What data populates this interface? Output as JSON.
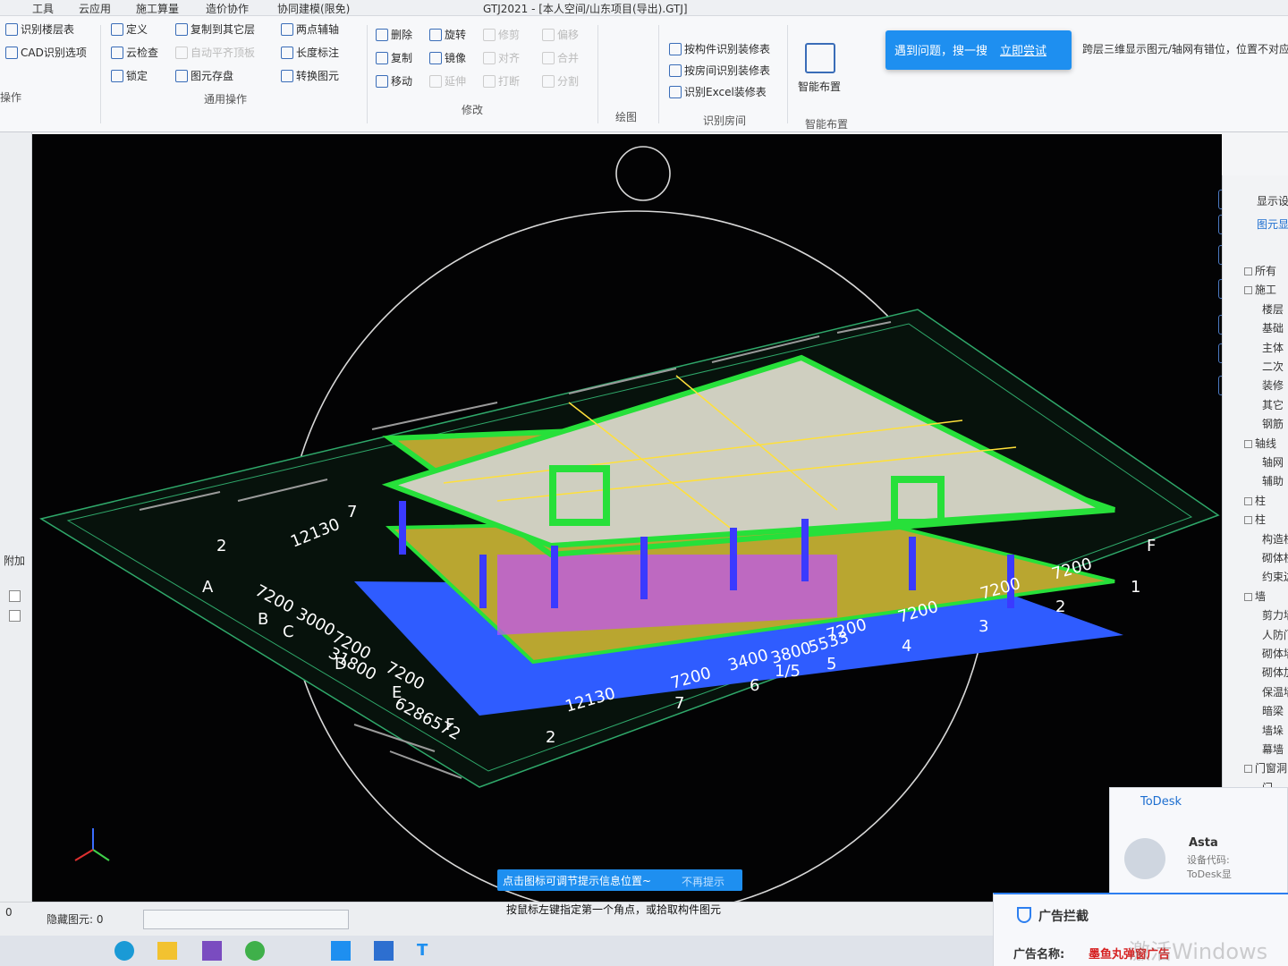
{
  "menubar": {
    "items": [
      "工具",
      "云应用",
      "施工算量",
      "造价协作",
      "协同建模(限免)"
    ],
    "doc_title": "GTJ2021 - [本人空间/山东项目(导出).GTJ]"
  },
  "ribbon": {
    "col1": [
      "识别楼层表",
      "CAD识别选项"
    ],
    "col1_group": "操作",
    "col2": [
      "定义",
      "云检查",
      "锁定"
    ],
    "col3": [
      "复制到其它层",
      "自动平齐顶板",
      "图元存盘"
    ],
    "col4": [
      "两点辅轴",
      "长度标注",
      "转换图元"
    ],
    "group_general": "通用操作",
    "modify_col1": [
      "删除",
      "复制",
      "移动"
    ],
    "modify_col2": [
      "旋转",
      "镜像",
      "延伸"
    ],
    "modify_col3": [
      "修剪",
      "对齐",
      "打断"
    ],
    "modify_col4": [
      "偏移",
      "合并",
      "分割"
    ],
    "group_modify": "修改",
    "group_draw": "绘图",
    "recognize_room": [
      "按构件识别装修表",
      "按房间识别装修表",
      "识别Excel装修表"
    ],
    "group_room": "识别房间",
    "smart_layout": "智能布置",
    "group_smart": "智能布置"
  },
  "ai_search": {
    "text": "遇到问题，搜一搜",
    "button": "立即尝试",
    "hint": "跨层三维显示图元/轴网有错位，位置不对应"
  },
  "left": {
    "add_label": "附加"
  },
  "viewport": {
    "dims": [
      "12130",
      "7200",
      "3000",
      "7200",
      "31800",
      "7200",
      "6286572",
      "12130",
      "7200",
      "3400",
      "3800",
      "5533",
      "7200",
      "7200",
      "7200",
      "7200",
      "1/5"
    ],
    "axis_letters": [
      "A",
      "B",
      "C",
      "D",
      "E",
      "F",
      "F"
    ],
    "axis_numbers": [
      "2",
      "7",
      "2",
      "7",
      "6",
      "5",
      "4",
      "3",
      "2",
      "1"
    ]
  },
  "rightpanel": {
    "header": "显示设置",
    "tab": "图元显示",
    "items": [
      "所有",
      "施工",
      "楼层",
      "基础",
      "主体",
      "二次",
      "装修",
      "其它",
      "钢筋",
      "轴线",
      "轴网",
      "辅助",
      "柱",
      "柱",
      "构造柱",
      "砌体柱",
      "约束边",
      "墙",
      "剪力墙",
      "人防门框墙",
      "砌体墙",
      "砌体加筋",
      "保温墙",
      "暗梁",
      "墙垛",
      "幕墙",
      "门窗洞",
      "门"
    ]
  },
  "tip_banner": {
    "text": "点击图标可调节提示信息位置~",
    "dismiss": "不再提示"
  },
  "prompt": "按鼠标左键指定第一个角点，或拾取构件图元",
  "status": {
    "hidden_label": "隐藏图元: 0",
    "left_zero": "0"
  },
  "todesk": {
    "brand": "ToDesk",
    "user": "Asta",
    "code_label": "设备代码: ",
    "sub": "ToDesk显"
  },
  "adblock": {
    "title": "广告拦截",
    "name_label": "广告名称: ",
    "name_value": "墨鱼丸弹窗广告"
  },
  "watermark": "激活Windows",
  "colors": {
    "viewport_bg": "#030304",
    "slab_green": "#27e03a",
    "wall_olive": "#b9a630",
    "column_blue": "#3a3aff",
    "foundation_blue": "#2f5cff",
    "accent": "#1e8ff0"
  }
}
